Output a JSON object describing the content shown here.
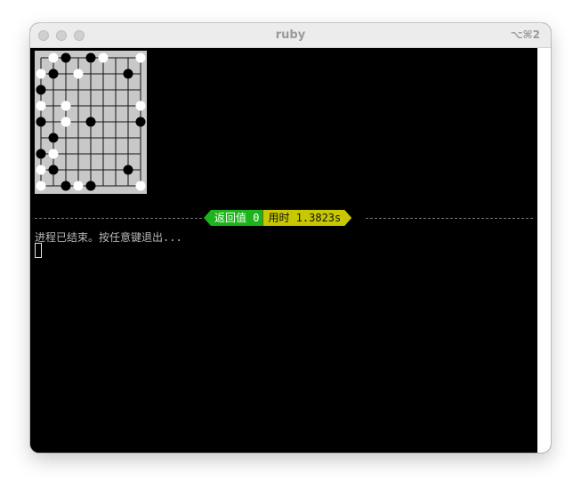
{
  "window": {
    "title": "ruby",
    "shortcut": "⌥⌘2"
  },
  "board": {
    "size": 9,
    "stones": [
      {
        "col": 1,
        "row": 0,
        "color": "white"
      },
      {
        "col": 2,
        "row": 0,
        "color": "black"
      },
      {
        "col": 4,
        "row": 0,
        "color": "black"
      },
      {
        "col": 5,
        "row": 0,
        "color": "white"
      },
      {
        "col": 8,
        "row": 0,
        "color": "white"
      },
      {
        "col": 0,
        "row": 1,
        "color": "white"
      },
      {
        "col": 1,
        "row": 1,
        "color": "black"
      },
      {
        "col": 3,
        "row": 1,
        "color": "white"
      },
      {
        "col": 7,
        "row": 1,
        "color": "black"
      },
      {
        "col": 0,
        "row": 2,
        "color": "black"
      },
      {
        "col": 0,
        "row": 3,
        "color": "white"
      },
      {
        "col": 2,
        "row": 3,
        "color": "white"
      },
      {
        "col": 8,
        "row": 3,
        "color": "white"
      },
      {
        "col": 0,
        "row": 4,
        "color": "black"
      },
      {
        "col": 2,
        "row": 4,
        "color": "white"
      },
      {
        "col": 4,
        "row": 4,
        "color": "black"
      },
      {
        "col": 8,
        "row": 4,
        "color": "black"
      },
      {
        "col": 1,
        "row": 5,
        "color": "black"
      },
      {
        "col": 0,
        "row": 6,
        "color": "black"
      },
      {
        "col": 1,
        "row": 6,
        "color": "white"
      },
      {
        "col": 0,
        "row": 7,
        "color": "white"
      },
      {
        "col": 1,
        "row": 7,
        "color": "black"
      },
      {
        "col": 7,
        "row": 7,
        "color": "black"
      },
      {
        "col": 0,
        "row": 8,
        "color": "white"
      },
      {
        "col": 2,
        "row": 8,
        "color": "black"
      },
      {
        "col": 3,
        "row": 8,
        "color": "white"
      },
      {
        "col": 4,
        "row": 8,
        "color": "black"
      },
      {
        "col": 8,
        "row": 8,
        "color": "white"
      }
    ]
  },
  "status": {
    "return_label": "返回值 0",
    "time_label": "用时 1.3823s"
  },
  "terminal": {
    "message": "进程已结束。按任意键退出..."
  },
  "colors": {
    "return_bg": "#1db31d",
    "time_bg": "#c8c800",
    "board_bg": "#c8c8c8"
  }
}
